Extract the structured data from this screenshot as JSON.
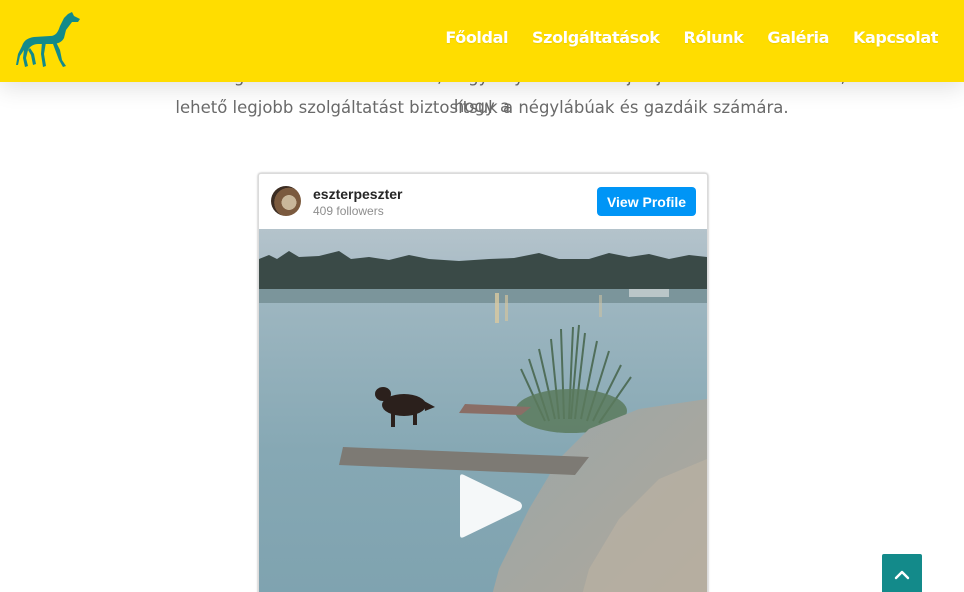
{
  "header": {
    "logo_icon": "greyhound-dog-icon",
    "nav": [
      {
        "label": "Főoldal"
      },
      {
        "label": "Szolgáltatások"
      },
      {
        "label": "Rólunk"
      },
      {
        "label": "Galéria"
      },
      {
        "label": "Kapcsolat"
      }
    ]
  },
  "intro": {
    "line1": "elkötelezettségünkről. Arra törekszünk, hogy folyamatosan fejlődjünk annak érdekében, hogy a",
    "line2": "lehető legjobb szolgáltatást biztosítsuk a négylábúak és gazdáik számára."
  },
  "instagram": {
    "username": "eszterpeszter",
    "followers": "409 followers",
    "view_profile": "View Profile",
    "media_icon": "play-icon"
  },
  "back_to_top_icon": "chevron-up-icon",
  "colors": {
    "header_bg": "#ffdd00",
    "logo": "#138a8a",
    "button_blue": "#0095f6",
    "to_top_bg": "#138a8a"
  }
}
